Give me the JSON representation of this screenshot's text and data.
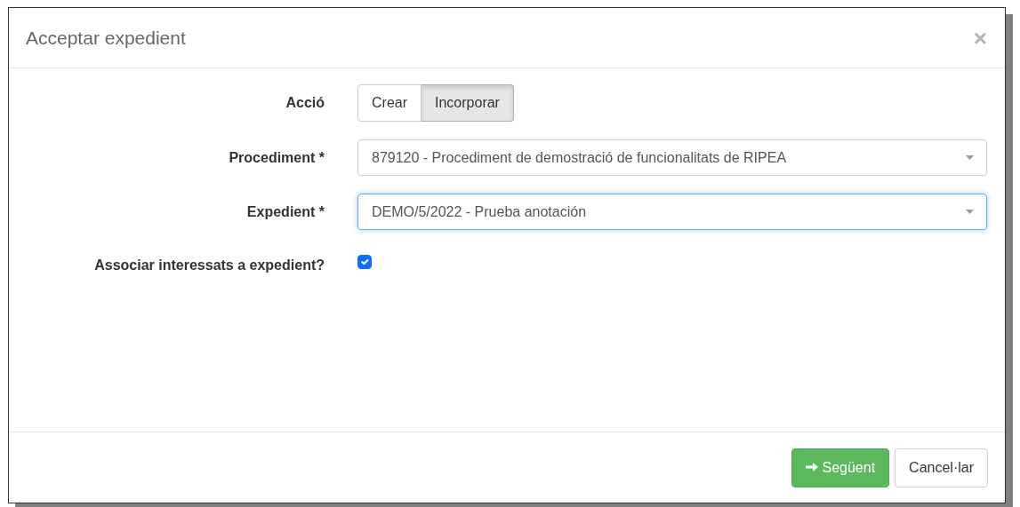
{
  "dialog": {
    "title": "Acceptar expedient",
    "close": "×"
  },
  "fields": [
    {
      "kind": "toggle",
      "label": "Acció",
      "options": [
        {
          "label": "Crear",
          "selected": false
        },
        {
          "label": "Incorporar",
          "selected": true
        }
      ]
    },
    {
      "kind": "select",
      "label": "Procediment *",
      "value": "879120 - Procediment de demostració de funcionalitats de RIPEA",
      "focused": false
    },
    {
      "kind": "select",
      "label": "Expedient *",
      "value": "DEMO/5/2022 - Prueba anotación",
      "focused": true
    },
    {
      "kind": "checkbox",
      "label": "Associar interessats a expedient?",
      "checked": true
    }
  ],
  "buttons": [
    {
      "kind": "primary",
      "label": "Següent"
    },
    {
      "kind": "default",
      "label": "Cancel·lar"
    }
  ]
}
